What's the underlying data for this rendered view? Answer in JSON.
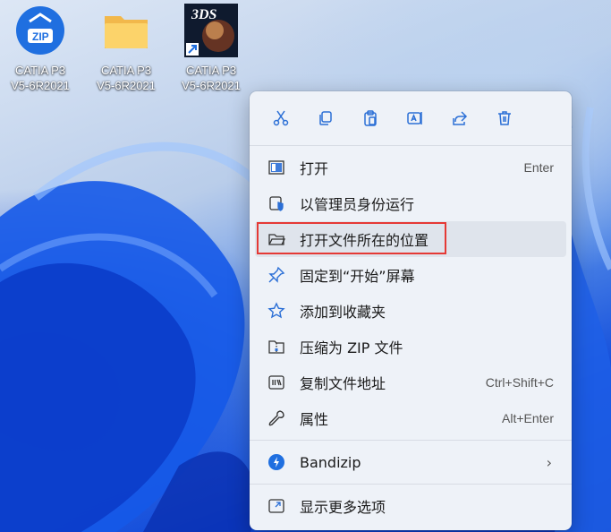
{
  "desktop": {
    "icons": [
      {
        "name": "zip-archive",
        "label_line1": "CATIA P3",
        "label_line2": "V5-6R2021",
        "badge": "ZIP"
      },
      {
        "name": "folder",
        "label_line1": "CATIA P3",
        "label_line2": "V5-6R2021"
      },
      {
        "name": "catia-shortcut",
        "label_line1": "CATIA P3",
        "label_line2": "V5-6R2021",
        "badge": "3DS"
      }
    ]
  },
  "toolbar": {
    "cut_icon": "scissors-icon",
    "copy_icon": "copy-icon",
    "paste_icon": "paste-icon",
    "rename_icon": "rename-icon",
    "share_icon": "share-icon",
    "delete_icon": "trash-icon"
  },
  "menu": {
    "items": [
      {
        "label": "打开",
        "shortcut": "Enter",
        "icon": "open-icon"
      },
      {
        "label": "以管理员身份运行",
        "shortcut": "",
        "icon": "shield-icon"
      },
      {
        "label": "打开文件所在的位置",
        "shortcut": "",
        "icon": "folder-icon"
      },
      {
        "label": "固定到“开始”屏幕",
        "shortcut": "",
        "icon": "pin-icon"
      },
      {
        "label": "添加到收藏夹",
        "shortcut": "",
        "icon": "star-icon"
      },
      {
        "label": "压缩为 ZIP 文件",
        "shortcut": "",
        "icon": "zip-folder-icon"
      },
      {
        "label": "复制文件地址",
        "shortcut": "Ctrl+Shift+C",
        "icon": "copy-path-icon"
      },
      {
        "label": "属性",
        "shortcut": "Alt+Enter",
        "icon": "wrench-icon"
      }
    ],
    "bandizip": {
      "label": "Bandizip",
      "icon": "bandizip-icon"
    },
    "more": {
      "label": "显示更多选项",
      "icon": "more-options-icon"
    }
  },
  "colors": {
    "accent": "#2b6fd6",
    "highlight": "#e53935"
  }
}
